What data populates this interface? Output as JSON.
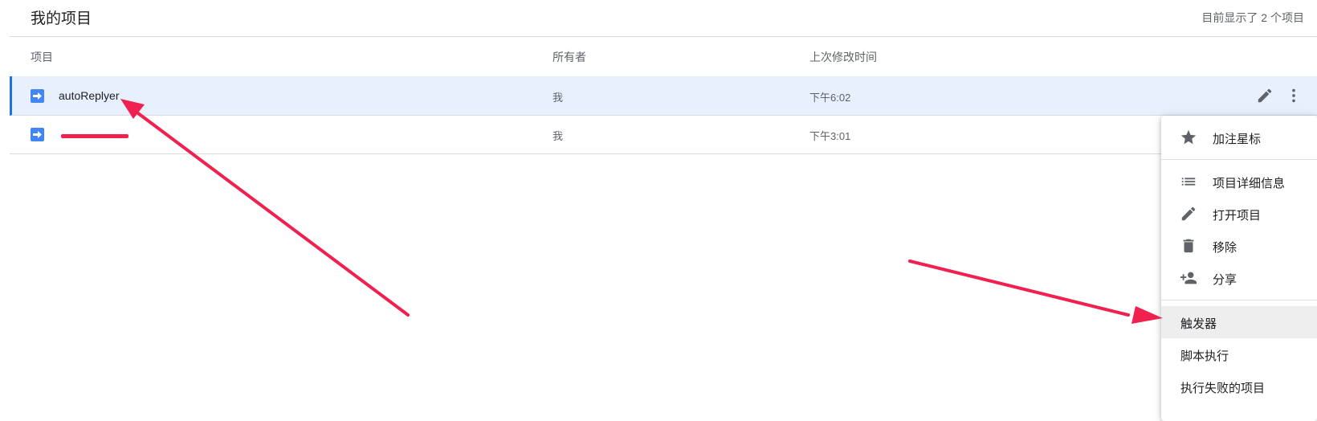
{
  "header": {
    "title": "我的项目",
    "count_text": "目前显示了 2 个项目"
  },
  "columns": {
    "name": "项目",
    "owner": "所有者",
    "modified": "上次修改时间"
  },
  "rows": [
    {
      "name": "autoReplyer",
      "owner": "我",
      "modified": "下午6:02"
    },
    {
      "name": "",
      "owner": "我",
      "modified": "下午3:01"
    }
  ],
  "menu": {
    "items": [
      {
        "label": "加注星标",
        "icon": "star-icon"
      },
      {
        "label": "项目详细信息",
        "icon": "list-icon"
      },
      {
        "label": "打开项目",
        "icon": "pencil-icon"
      },
      {
        "label": "移除",
        "icon": "trash-icon"
      },
      {
        "label": "分享",
        "icon": "person-add-icon"
      },
      {
        "label": "触发器",
        "icon": ""
      },
      {
        "label": "脚本执行",
        "icon": ""
      },
      {
        "label": "执行失败的项目",
        "icon": ""
      }
    ]
  },
  "colors": {
    "accent": "#1a73e8",
    "selected_row_bg": "#e8f0fe",
    "project_icon": "#4285f4",
    "annotation_arrow": "#f0204f"
  }
}
